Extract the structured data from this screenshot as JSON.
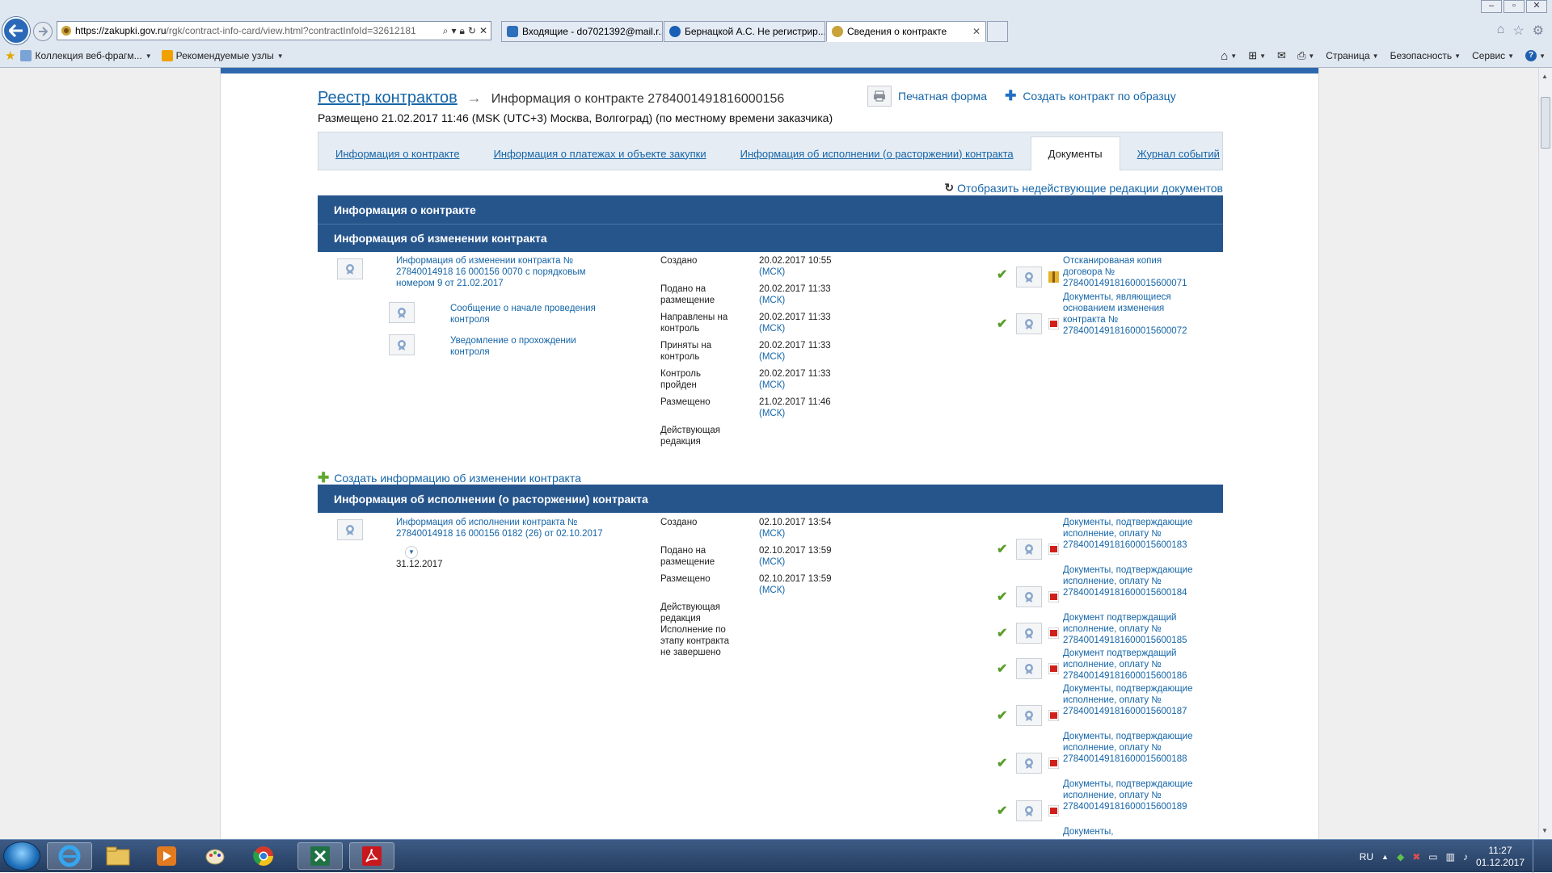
{
  "browser": {
    "url_host": "https://zakupki.gov.ru",
    "url_path": "/rgk/contract-info-card/view.html?contractInfoId=32612181",
    "tabs": [
      {
        "label": "Входящие - do7021392@mail.r..."
      },
      {
        "label": "Бернацкой А.С. Не регистрир..."
      },
      {
        "label": "Сведения о контракте"
      }
    ],
    "favorites": [
      {
        "label": "Коллекция веб-фрагм..."
      },
      {
        "label": "Рекомендуемые узлы"
      }
    ],
    "commands": {
      "page": "Страница",
      "security": "Безопасность",
      "service": "Сервис"
    }
  },
  "page": {
    "breadcrumb_root": "Реестр контрактов",
    "title": "Информация о контракте 2784001491816000156",
    "posted": "Размещено 21.02.2017 11:46 (MSK (UTC+3) Москва, Волгоград) (по местному времени заказчика)",
    "print_form": "Печатная форма",
    "create_by_sample": "Создать контракт по образцу",
    "tabs": [
      {
        "label": "Информация о контракте"
      },
      {
        "label": "Информация о платежах и объекте закупки"
      },
      {
        "label": "Информация об исполнении (о расторжении) контракта"
      },
      {
        "label": "Документы"
      },
      {
        "label": "Журнал событий"
      }
    ],
    "show_inactive": "Отобразить недействующие редакции документов",
    "section_contract_info": "Информация о контракте",
    "section_change_info": "Информация об изменении контракта",
    "change": {
      "link": "Информация об изменении контракта № 27840014918 16 000156 0070 с порядковым номером 9 от 21.02.2017",
      "sub1": "Сообщение о начале проведения контроля",
      "sub2": "Уведомление о прохождении контроля",
      "statuses": [
        {
          "label": "Создано",
          "date": "20.02.2017 10:55",
          "tz": "(МСК)"
        },
        {
          "label": "Подано на размещение",
          "date": "20.02.2017 11:33",
          "tz": "(МСК)"
        },
        {
          "label": "Направлены на контроль",
          "date": "20.02.2017 11:33",
          "tz": "(МСК)"
        },
        {
          "label": "Приняты на контроль",
          "date": "20.02.2017 11:33",
          "tz": "(МСК)"
        },
        {
          "label": "Контроль пройден",
          "date": "20.02.2017 11:33",
          "tz": "(МСК)"
        },
        {
          "label": "Размещено",
          "date": "21.02.2017 11:46",
          "tz": "(МСК)"
        }
      ],
      "current": "Действующая редакция",
      "docs": [
        {
          "text": "Отсканированая копия договора № 278400149181600015600071"
        },
        {
          "text": "Документы, являющиеся основанием изменения контракта № 278400149181600015600072"
        }
      ]
    },
    "create_change": "Создать информацию об изменении контракта",
    "section_execution": "Информация об исполнении (о расторжении) контракта",
    "execution": {
      "link": "Информация об исполнении контракта № 27840014918 16 000156 0182 (26) от 02.10.2017",
      "date_below": "31.12.2017",
      "statuses": [
        {
          "label": "Создано",
          "date": "02.10.2017 13:54",
          "tz": "(МСК)"
        },
        {
          "label": "Подано на размещение",
          "date": "02.10.2017 13:59",
          "tz": "(МСК)"
        },
        {
          "label": "Размещено",
          "date": "02.10.2017 13:59",
          "tz": "(МСК)"
        }
      ],
      "current": "Действующая редакция",
      "stage_note": "Исполнение по этапу контракта не завершено",
      "docs": [
        {
          "text": "Документы, подтверждающие исполнение, оплату № 278400149181600015600183"
        },
        {
          "text": "Документы, подтверждающие исполнение, оплату № 278400149181600015600184"
        },
        {
          "text": "Документ подтверждащий исполнение, оплату № 278400149181600015600185"
        },
        {
          "text": "Документ подтверждащий исполнение, оплату № 278400149181600015600186"
        },
        {
          "text": "Документы, подтверждающие исполнение, оплату № 278400149181600015600187"
        },
        {
          "text": "Документы, подтверждающие исполнение, оплату № 278400149181600015600188"
        },
        {
          "text": "Документы, подтверждающие исполнение, оплату № 278400149181600015600189"
        },
        {
          "text": "Документы,"
        }
      ]
    }
  },
  "taskbar": {
    "lang": "RU",
    "time": "11:27",
    "date": "01.12.2017"
  },
  "colors": {
    "section": "#26558c",
    "link": "#1565a7",
    "topbar": "#2d68ad",
    "check": "#5b9e2a"
  }
}
